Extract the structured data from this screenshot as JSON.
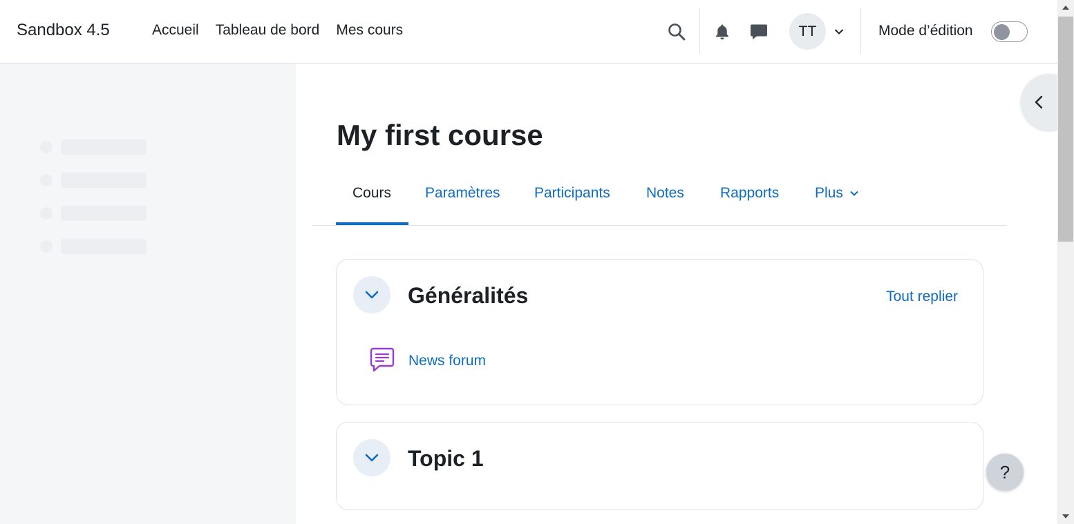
{
  "navbar": {
    "brand": "Sandbox 4.5",
    "links": [
      "Accueil",
      "Tableau de bord",
      "Mes cours"
    ],
    "avatar_initials": "TT",
    "edit_mode_label": "Mode d’édition",
    "edit_mode_on": false
  },
  "course": {
    "title": "My first course"
  },
  "tabs": {
    "items": [
      "Cours",
      "Paramètres",
      "Participants",
      "Notes",
      "Rapports",
      "Plus"
    ],
    "active": "Cours"
  },
  "sections": [
    {
      "title": "Généralités",
      "collapse_all": "Tout replier",
      "activities": [
        {
          "name": "News forum",
          "icon": "forum-icon"
        }
      ]
    },
    {
      "title": "Topic 1"
    }
  ],
  "help": {
    "label": "?"
  },
  "colors": {
    "link": "#0f6cbf",
    "forum_icon": "#9a3bd0",
    "drawer_bg": "#f5f6f8"
  }
}
